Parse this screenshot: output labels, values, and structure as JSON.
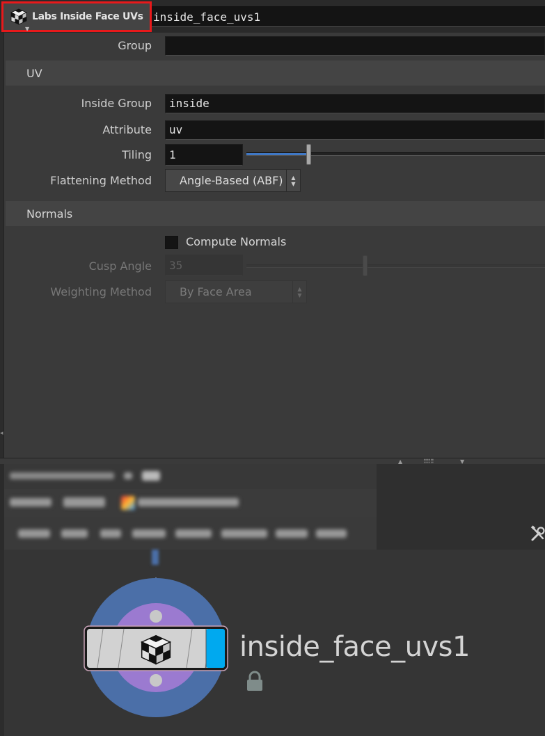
{
  "header": {
    "node_type_label": "Labs Inside Face UVs",
    "node_type_icon": "checker-cube-icon",
    "node_name": "inside_face_uvs1"
  },
  "params": {
    "group": {
      "label": "Group",
      "value": ""
    },
    "uv_folder": {
      "label": "UV"
    },
    "inside_group": {
      "label": "Inside Group",
      "value": "inside"
    },
    "attribute": {
      "label": "Attribute",
      "value": "uv"
    },
    "tiling": {
      "label": "Tiling",
      "value": "1",
      "slider_level": 0.2
    },
    "flattening_method": {
      "label": "Flattening Method",
      "value": "Angle-Based (ABF)"
    },
    "normals_folder": {
      "label": "Normals"
    },
    "compute_normals": {
      "label": "Compute Normals",
      "checked": false
    },
    "cusp_angle": {
      "label": "Cusp Angle",
      "value": "35",
      "slider_level": 0.39,
      "enabled": false
    },
    "weighting_method": {
      "label": "Weighting Method",
      "value": "By Face Area",
      "enabled": false
    }
  },
  "network": {
    "node_label": "inside_face_uvs1",
    "node_locked": true,
    "node_flag_color": "#00a9ef",
    "ring_outer_color": "#4b6fa8",
    "ring_inner_color": "#9b7ad0",
    "tools_icon": "wrench-screwdriver-icon"
  },
  "colors": {
    "highlight_border": "#e8191b",
    "slider_fill": "#3f78c6",
    "panel_bg": "#3a3a3a",
    "field_bg": "#141414"
  }
}
